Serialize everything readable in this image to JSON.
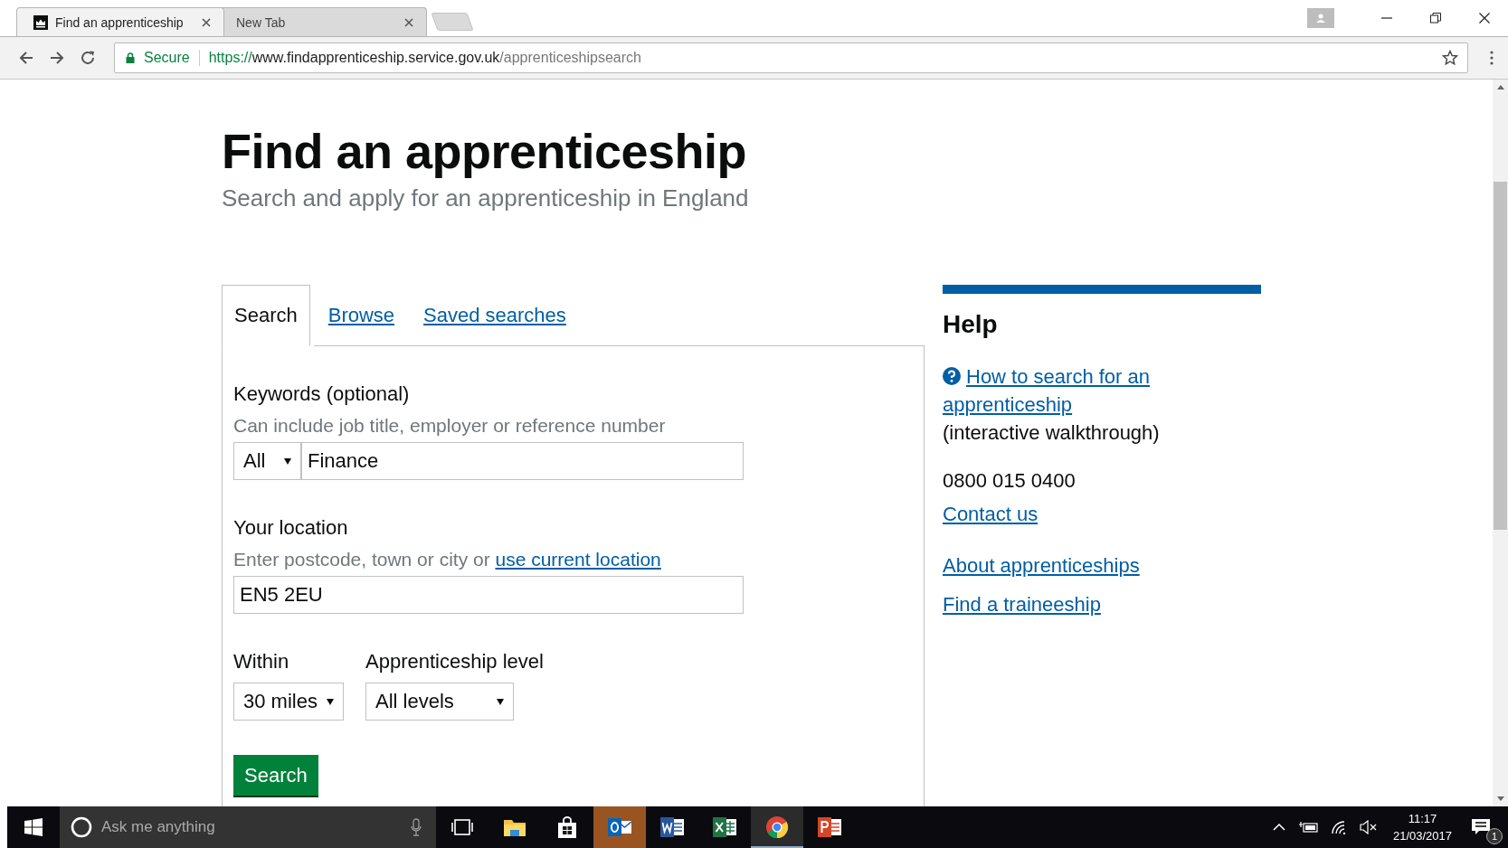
{
  "browser": {
    "tabs": [
      {
        "title": "Find an apprenticeship",
        "selected": true,
        "has_favicon": true
      },
      {
        "title": "New Tab",
        "selected": false,
        "has_favicon": false
      }
    ],
    "address": {
      "secure_label": "Secure",
      "url_scheme": "https://",
      "url_host": "www.findapprenticeship.service.gov.uk",
      "url_path": "/apprenticeshipsearch"
    }
  },
  "page": {
    "title": "Find an apprenticeship",
    "subtitle": "Search and apply for an apprenticeship in England",
    "tabs": [
      {
        "label": "Search",
        "selected": true
      },
      {
        "label": "Browse",
        "selected": false
      },
      {
        "label": "Saved searches",
        "selected": false
      }
    ],
    "keywords": {
      "label": "Keywords (optional)",
      "hint": "Can include job title, employer or reference number",
      "scope": "All",
      "value": "Finance"
    },
    "location": {
      "label": "Your location",
      "hint": "Enter postcode, town or city or",
      "hint_link": "use current location",
      "value": "EN5 2EU"
    },
    "within": {
      "label": "Within",
      "value": "30 miles"
    },
    "level": {
      "label": "Apprenticeship level",
      "value": "All levels"
    },
    "search_button": "Search",
    "help": {
      "title": "Help",
      "walkthrough_link": "How to search for an apprenticeship",
      "walkthrough_note": "(interactive walkthrough)",
      "phone": "0800 015 0400",
      "contact_link": "Contact us",
      "links": [
        "About apprenticeships",
        "Find a traineeship"
      ]
    }
  },
  "taskbar": {
    "search_placeholder": "Ask me anything",
    "apps": [
      {
        "kind": "taskview",
        "attention": false,
        "running": false
      },
      {
        "kind": "explorer",
        "attention": false,
        "running": false
      },
      {
        "kind": "store",
        "attention": false,
        "running": false
      },
      {
        "kind": "outlook",
        "attention": true,
        "running": false
      },
      {
        "kind": "word",
        "attention": false,
        "running": false
      },
      {
        "kind": "excel",
        "attention": false,
        "running": false
      },
      {
        "kind": "chrome",
        "attention": false,
        "running": true
      },
      {
        "kind": "powerpoint",
        "attention": false,
        "running": false
      }
    ],
    "time": "11:17",
    "date": "21/03/2017",
    "notification_count": "1"
  }
}
